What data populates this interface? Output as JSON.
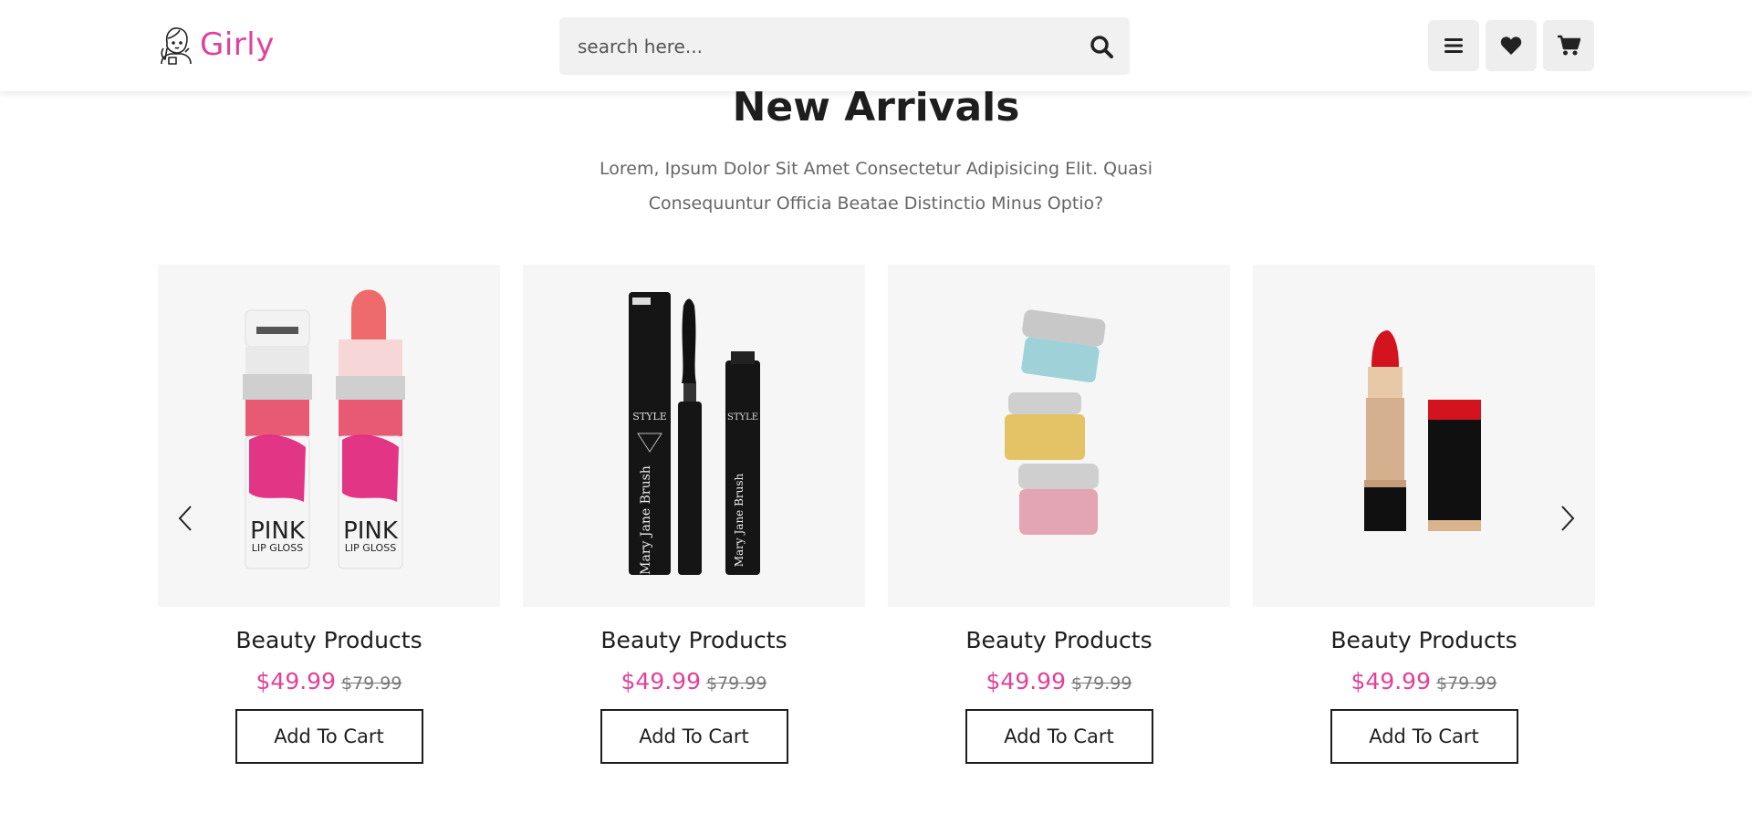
{
  "brand": {
    "name": "Girly",
    "accent": "#e0429a"
  },
  "search": {
    "placeholder": "search here..."
  },
  "header_icons": [
    "menu-icon",
    "heart-icon",
    "cart-icon"
  ],
  "section": {
    "title": "New Arrivals",
    "description": "Lorem, Ipsum Dolor Sit Amet Consectetur Adipisicing Elit. Quasi Consequuntur Officia Beatae Distinctio Minus Optio?"
  },
  "products": [
    {
      "image": "pink-lip-gloss",
      "name": "Beauty Products",
      "price": "$49.99",
      "old_price": "$79.99",
      "button": "Add To Cart"
    },
    {
      "image": "mascara",
      "name": "Beauty Products",
      "price": "$49.99",
      "old_price": "$79.99",
      "button": "Add To Cart"
    },
    {
      "image": "cream-jars",
      "name": "Beauty Products",
      "price": "$49.99",
      "old_price": "$79.99",
      "button": "Add To Cart"
    },
    {
      "image": "red-lipstick",
      "name": "Beauty Products",
      "price": "$49.99",
      "old_price": "$79.99",
      "button": "Add To Cart"
    }
  ],
  "carousel": {
    "prev_icon": "chevron-left-icon",
    "next_icon": "chevron-right-icon"
  }
}
